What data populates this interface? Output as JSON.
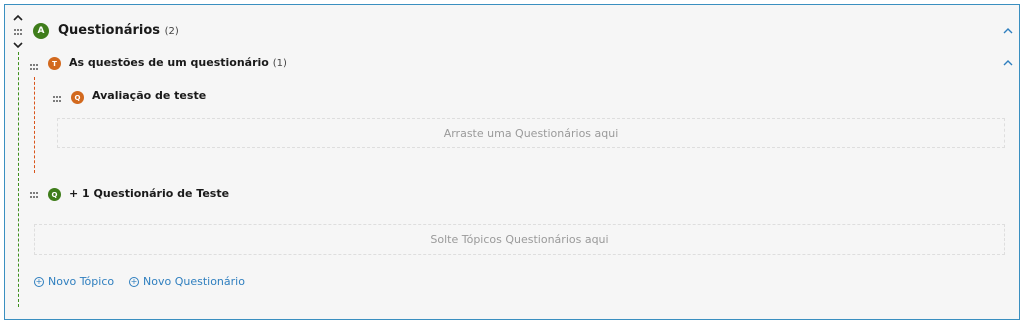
{
  "section": {
    "badge": "A",
    "title": "Questionários",
    "count": "(2)"
  },
  "topic": {
    "badge": "T",
    "title": "As questões de um questionário",
    "count": "(1)",
    "quiz": {
      "badge": "Q",
      "title": "Avaliação de teste"
    },
    "dropzone": "Arraste uma Questionários aqui"
  },
  "quiz2": {
    "badge": "Q",
    "title": "+ 1 Questionário de Teste"
  },
  "section_dropzone": "Solte Tópicos Questionários aqui",
  "actions": {
    "new_topic": "Novo Tópico",
    "new_quiz": "Novo Questionário"
  },
  "colors": {
    "section_badge": "#3f7d1b",
    "topic_badge": "#d2691e",
    "link": "#2f7fbf",
    "border": "#3a8fc0"
  }
}
